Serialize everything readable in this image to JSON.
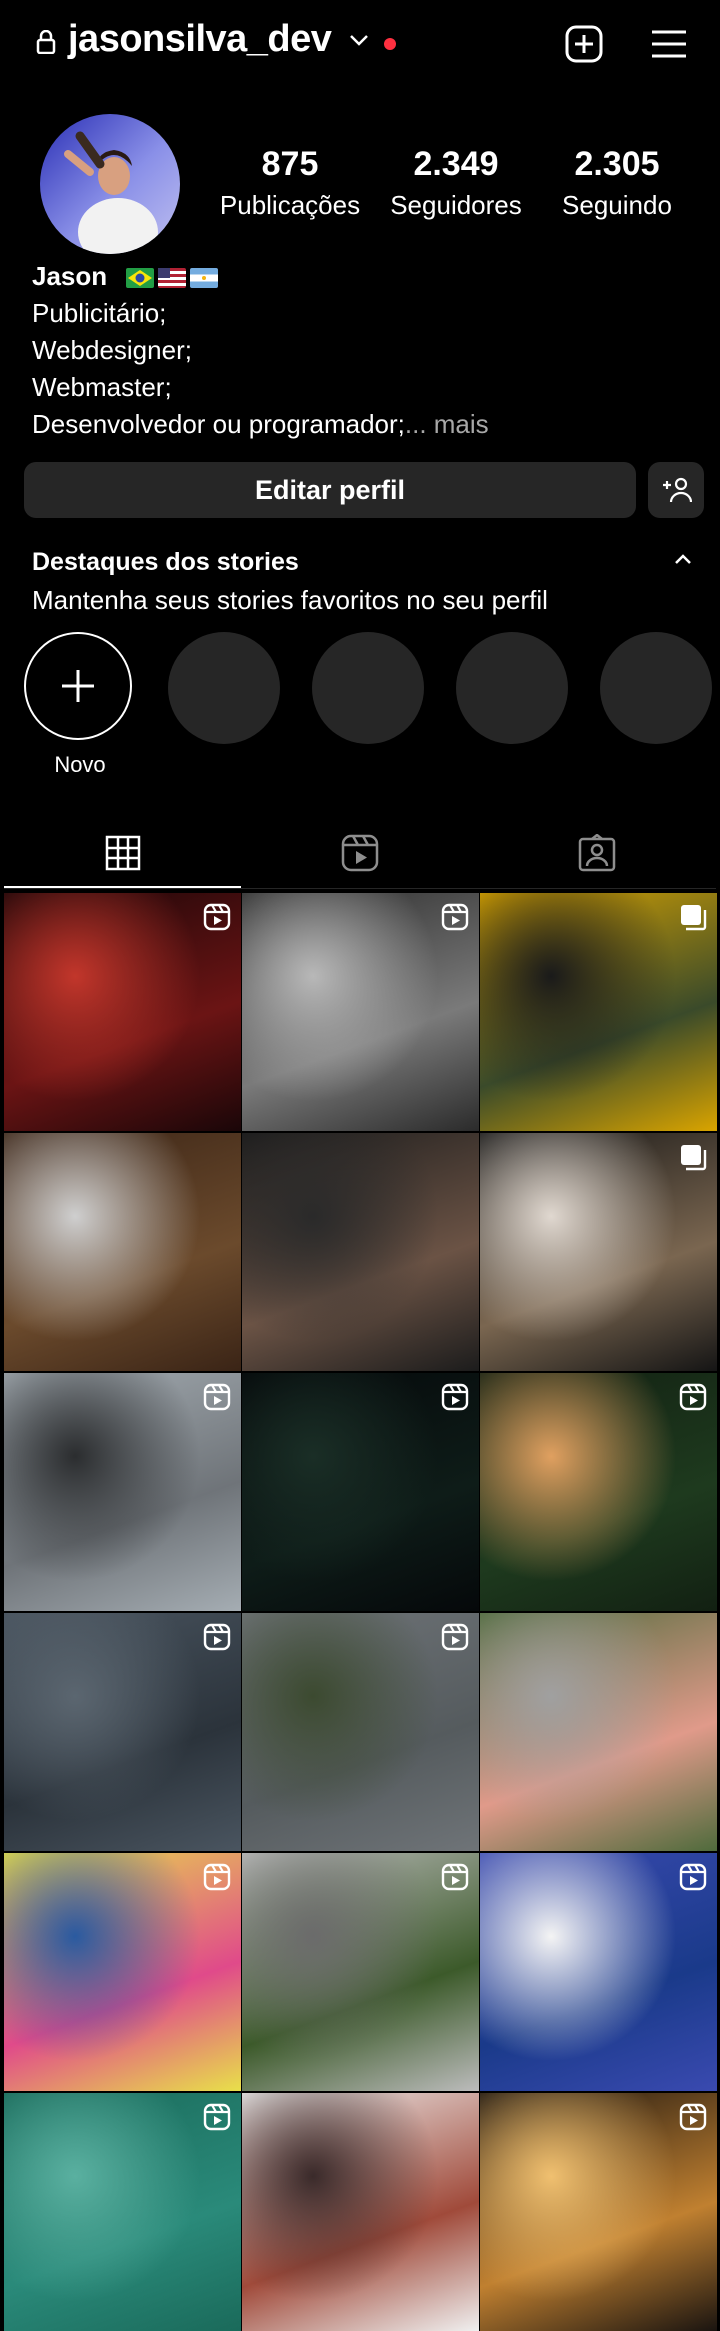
{
  "header": {
    "username": "jasonsilva_dev"
  },
  "profile": {
    "stats": [
      {
        "value": "875",
        "label": "Publicações"
      },
      {
        "value": "2.349",
        "label": "Seguidores"
      },
      {
        "value": "2.305",
        "label": "Seguindo"
      }
    ],
    "name": "Jason",
    "bio_lines": [
      "Publicitário;",
      "Webdesigner;",
      "Webmaster;"
    ],
    "bio_last": "Desenvolvedor ou programador;",
    "more": "... mais",
    "edit_label": "Editar perfil"
  },
  "highlights": {
    "title": "Destaques dos stories",
    "subtitle": "Mantenha seus stories favoritos no seu perfil",
    "new_label": "Novo"
  },
  "posts": [
    {
      "colors": [
        "#1a0608",
        "#6b1414",
        "#c2362b"
      ],
      "badge": "reel-icon"
    },
    {
      "colors": [
        "#2b2b2b",
        "#7a7a7a",
        "#b8b8b8"
      ],
      "badge": "reel-icon"
    },
    {
      "colors": [
        "#d9a400",
        "#3a4a2a",
        "#1a1a1a"
      ],
      "badge": "carousel-icon"
    },
    {
      "colors": [
        "#3a2416",
        "#6b4a2c",
        "#cfcfcf"
      ],
      "badge": "none"
    },
    {
      "colors": [
        "#1c1c1c",
        "#6b5345",
        "#2a2a2a"
      ],
      "badge": "none"
    },
    {
      "colors": [
        "#151515",
        "#7a6650",
        "#e0d8d0"
      ],
      "badge": "carousel-icon"
    },
    {
      "colors": [
        "#a5adb3",
        "#6f7479",
        "#2b2d2f"
      ],
      "badge": "reel-icon"
    },
    {
      "colors": [
        "#05080a",
        "#0e1c18",
        "#1a2e26"
      ],
      "badge": "reel-icon"
    },
    {
      "colors": [
        "#122012",
        "#1e3a1e",
        "#e0a060"
      ],
      "badge": "reel-icon"
    },
    {
      "colors": [
        "#4a5560",
        "#2b333b",
        "#5b6670"
      ],
      "badge": "reel-icon"
    },
    {
      "colors": [
        "#6f7478",
        "#555b5e",
        "#3c4a30"
      ],
      "badge": "reel-icon"
    },
    {
      "colors": [
        "#4f6b3c",
        "#e09a8a",
        "#a0a0a0"
      ],
      "badge": "none"
    },
    {
      "colors": [
        "#e8e04a",
        "#e04a8a",
        "#2a5aa0"
      ],
      "badge": "reel-icon"
    },
    {
      "colors": [
        "#bcbcbc",
        "#3c5a2a",
        "#6b6b6b"
      ],
      "badge": "reel-icon"
    },
    {
      "colors": [
        "#3a4ab0",
        "#1a3a8a",
        "#f4f4f4"
      ],
      "badge": "reel-icon"
    },
    {
      "colors": [
        "#1a6a5a",
        "#2a8a7a",
        "#5ab0a0"
      ],
      "badge": "reel-icon"
    },
    {
      "colors": [
        "#f0f0f0",
        "#a04a3a",
        "#3a2a2a"
      ],
      "badge": "none"
    },
    {
      "colors": [
        "#1a1410",
        "#c08030",
        "#f0c070"
      ],
      "badge": "reel-icon"
    }
  ]
}
